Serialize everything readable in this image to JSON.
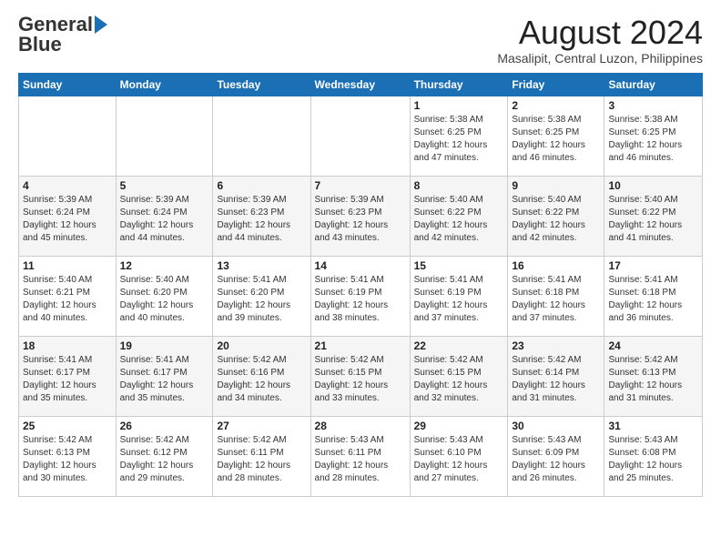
{
  "header": {
    "logo_line1": "General",
    "logo_line2": "Blue",
    "month_year": "August 2024",
    "location": "Masalipit, Central Luzon, Philippines"
  },
  "days_of_week": [
    "Sunday",
    "Monday",
    "Tuesday",
    "Wednesday",
    "Thursday",
    "Friday",
    "Saturday"
  ],
  "weeks": [
    [
      {
        "num": "",
        "info": ""
      },
      {
        "num": "",
        "info": ""
      },
      {
        "num": "",
        "info": ""
      },
      {
        "num": "",
        "info": ""
      },
      {
        "num": "1",
        "info": "Sunrise: 5:38 AM\nSunset: 6:25 PM\nDaylight: 12 hours\nand 47 minutes."
      },
      {
        "num": "2",
        "info": "Sunrise: 5:38 AM\nSunset: 6:25 PM\nDaylight: 12 hours\nand 46 minutes."
      },
      {
        "num": "3",
        "info": "Sunrise: 5:38 AM\nSunset: 6:25 PM\nDaylight: 12 hours\nand 46 minutes."
      }
    ],
    [
      {
        "num": "4",
        "info": "Sunrise: 5:39 AM\nSunset: 6:24 PM\nDaylight: 12 hours\nand 45 minutes."
      },
      {
        "num": "5",
        "info": "Sunrise: 5:39 AM\nSunset: 6:24 PM\nDaylight: 12 hours\nand 44 minutes."
      },
      {
        "num": "6",
        "info": "Sunrise: 5:39 AM\nSunset: 6:23 PM\nDaylight: 12 hours\nand 44 minutes."
      },
      {
        "num": "7",
        "info": "Sunrise: 5:39 AM\nSunset: 6:23 PM\nDaylight: 12 hours\nand 43 minutes."
      },
      {
        "num": "8",
        "info": "Sunrise: 5:40 AM\nSunset: 6:22 PM\nDaylight: 12 hours\nand 42 minutes."
      },
      {
        "num": "9",
        "info": "Sunrise: 5:40 AM\nSunset: 6:22 PM\nDaylight: 12 hours\nand 42 minutes."
      },
      {
        "num": "10",
        "info": "Sunrise: 5:40 AM\nSunset: 6:22 PM\nDaylight: 12 hours\nand 41 minutes."
      }
    ],
    [
      {
        "num": "11",
        "info": "Sunrise: 5:40 AM\nSunset: 6:21 PM\nDaylight: 12 hours\nand 40 minutes."
      },
      {
        "num": "12",
        "info": "Sunrise: 5:40 AM\nSunset: 6:20 PM\nDaylight: 12 hours\nand 40 minutes."
      },
      {
        "num": "13",
        "info": "Sunrise: 5:41 AM\nSunset: 6:20 PM\nDaylight: 12 hours\nand 39 minutes."
      },
      {
        "num": "14",
        "info": "Sunrise: 5:41 AM\nSunset: 6:19 PM\nDaylight: 12 hours\nand 38 minutes."
      },
      {
        "num": "15",
        "info": "Sunrise: 5:41 AM\nSunset: 6:19 PM\nDaylight: 12 hours\nand 37 minutes."
      },
      {
        "num": "16",
        "info": "Sunrise: 5:41 AM\nSunset: 6:18 PM\nDaylight: 12 hours\nand 37 minutes."
      },
      {
        "num": "17",
        "info": "Sunrise: 5:41 AM\nSunset: 6:18 PM\nDaylight: 12 hours\nand 36 minutes."
      }
    ],
    [
      {
        "num": "18",
        "info": "Sunrise: 5:41 AM\nSunset: 6:17 PM\nDaylight: 12 hours\nand 35 minutes."
      },
      {
        "num": "19",
        "info": "Sunrise: 5:41 AM\nSunset: 6:17 PM\nDaylight: 12 hours\nand 35 minutes."
      },
      {
        "num": "20",
        "info": "Sunrise: 5:42 AM\nSunset: 6:16 PM\nDaylight: 12 hours\nand 34 minutes."
      },
      {
        "num": "21",
        "info": "Sunrise: 5:42 AM\nSunset: 6:15 PM\nDaylight: 12 hours\nand 33 minutes."
      },
      {
        "num": "22",
        "info": "Sunrise: 5:42 AM\nSunset: 6:15 PM\nDaylight: 12 hours\nand 32 minutes."
      },
      {
        "num": "23",
        "info": "Sunrise: 5:42 AM\nSunset: 6:14 PM\nDaylight: 12 hours\nand 31 minutes."
      },
      {
        "num": "24",
        "info": "Sunrise: 5:42 AM\nSunset: 6:13 PM\nDaylight: 12 hours\nand 31 minutes."
      }
    ],
    [
      {
        "num": "25",
        "info": "Sunrise: 5:42 AM\nSunset: 6:13 PM\nDaylight: 12 hours\nand 30 minutes."
      },
      {
        "num": "26",
        "info": "Sunrise: 5:42 AM\nSunset: 6:12 PM\nDaylight: 12 hours\nand 29 minutes."
      },
      {
        "num": "27",
        "info": "Sunrise: 5:42 AM\nSunset: 6:11 PM\nDaylight: 12 hours\nand 28 minutes."
      },
      {
        "num": "28",
        "info": "Sunrise: 5:43 AM\nSunset: 6:11 PM\nDaylight: 12 hours\nand 28 minutes."
      },
      {
        "num": "29",
        "info": "Sunrise: 5:43 AM\nSunset: 6:10 PM\nDaylight: 12 hours\nand 27 minutes."
      },
      {
        "num": "30",
        "info": "Sunrise: 5:43 AM\nSunset: 6:09 PM\nDaylight: 12 hours\nand 26 minutes."
      },
      {
        "num": "31",
        "info": "Sunrise: 5:43 AM\nSunset: 6:08 PM\nDaylight: 12 hours\nand 25 minutes."
      }
    ]
  ]
}
